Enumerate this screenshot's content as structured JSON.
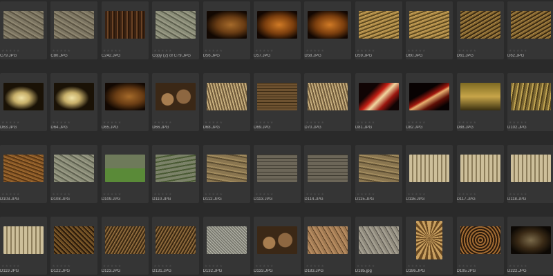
{
  "app": {
    "view": "thumbnail-grid",
    "background_color": "#2a2a2a",
    "cell_color": "#353535",
    "label_color": "#b9b9b9"
  },
  "rating_glyphs": "★★★★★",
  "thumbnails": [
    {
      "filename": "C79.JPG",
      "texture": "stone"
    },
    {
      "filename": "C80.JPG",
      "texture": "stone"
    },
    {
      "filename": "C242.JPG",
      "texture": "wood"
    },
    {
      "filename": "Copy (2) of C79.JPG",
      "texture": "stoneg"
    },
    {
      "filename": "D56.JPG",
      "texture": "cloth"
    },
    {
      "filename": "D57.JPG",
      "texture": "orange"
    },
    {
      "filename": "D58.JPG",
      "texture": "orange"
    },
    {
      "filename": "D59.JPG",
      "texture": "weave"
    },
    {
      "filename": "D60.JPG",
      "texture": "weave"
    },
    {
      "filename": "D61.JPG",
      "texture": "weaved"
    },
    {
      "filename": "D62.JPG",
      "texture": "weaved"
    },
    {
      "filename": "D63.JPG",
      "texture": "husk"
    },
    {
      "filename": "D64.JPG",
      "texture": "husk"
    },
    {
      "filename": "D65.JPG",
      "texture": "cloth"
    },
    {
      "filename": "D66.JPG",
      "texture": "bulb"
    },
    {
      "filename": "D68.JPG",
      "texture": "straw"
    },
    {
      "filename": "D69.JPG",
      "texture": "basket"
    },
    {
      "filename": "D70.JPG",
      "texture": "straw"
    },
    {
      "filename": "D81.JPG",
      "texture": "red"
    },
    {
      "filename": "D82.JPG",
      "texture": "redd"
    },
    {
      "filename": "D88.JPG",
      "texture": "floor"
    },
    {
      "filename": "D102.JPG",
      "texture": "bark"
    },
    {
      "filename": "D103.JPG",
      "texture": "soil"
    },
    {
      "filename": "D108.JPG",
      "texture": "stoneg"
    },
    {
      "filename": "D109.JPG",
      "texture": "grass"
    },
    {
      "filename": "D110.JPG",
      "texture": "stairs"
    },
    {
      "filename": "D112.JPG",
      "texture": "slab"
    },
    {
      "filename": "D113.JPG",
      "texture": "paving"
    },
    {
      "filename": "D114.JPG",
      "texture": "paving"
    },
    {
      "filename": "D115.JPG",
      "texture": "slab"
    },
    {
      "filename": "D116.JPG",
      "texture": "bricks"
    },
    {
      "filename": "D117.JPG",
      "texture": "bricks"
    },
    {
      "filename": "D118.JPG",
      "texture": "bricks"
    },
    {
      "filename": "D119.JPG",
      "texture": "bricks"
    },
    {
      "filename": "D122.JPG",
      "texture": "roots"
    },
    {
      "filename": "D123.JPG",
      "texture": "twigs"
    },
    {
      "filename": "D131.JPG",
      "texture": "twigs"
    },
    {
      "filename": "D132.JPG",
      "texture": "grid"
    },
    {
      "filename": "D133.JPG",
      "texture": "bulb"
    },
    {
      "filename": "D183.JPG",
      "texture": "crack"
    },
    {
      "filename": "D185.jpg",
      "texture": "crackg"
    },
    {
      "filename": "D186.JPG",
      "texture": "umbr",
      "orientation": "portrait"
    },
    {
      "filename": "D195.JPG",
      "texture": "honey"
    },
    {
      "filename": "D222.JPG",
      "texture": "dark"
    }
  ]
}
